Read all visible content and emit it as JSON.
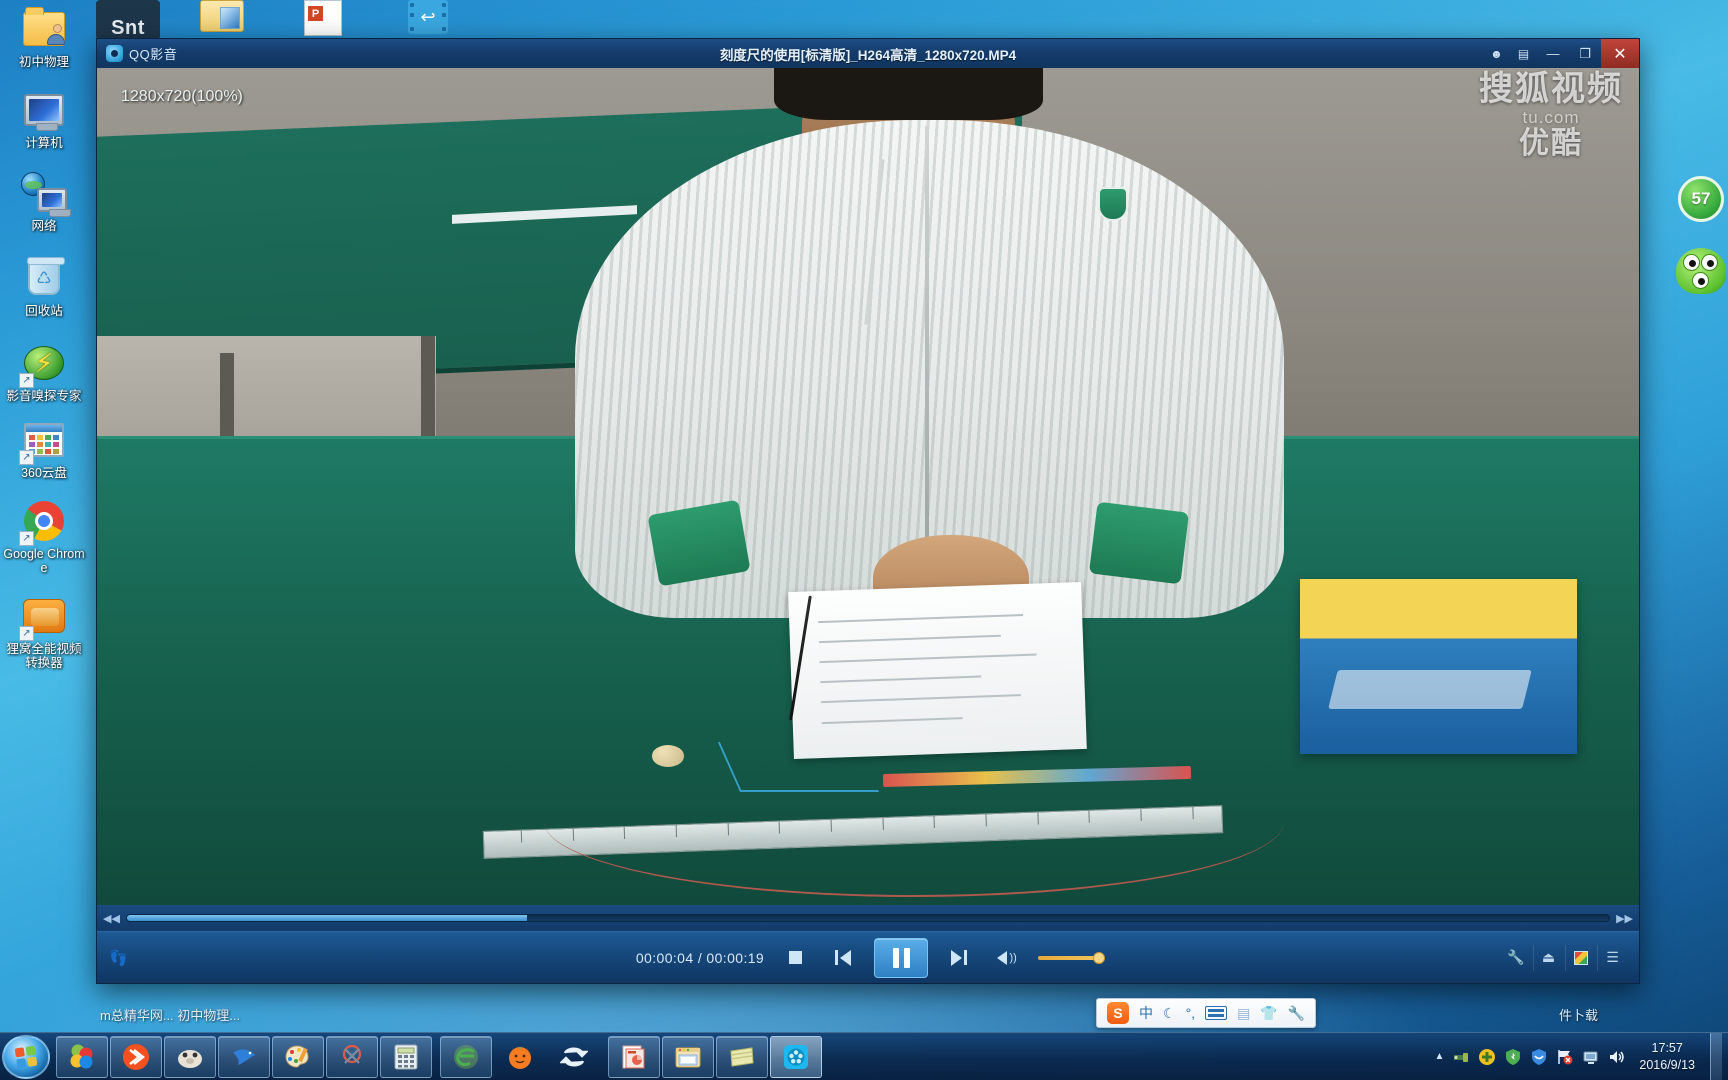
{
  "desktop": {
    "icons": [
      {
        "label": "初中物理",
        "icon": "folder-user-icon",
        "shortcut": false
      },
      {
        "label": "计算机",
        "icon": "computer-icon",
        "shortcut": false
      },
      {
        "label": "网络",
        "icon": "network-icon",
        "shortcut": false
      },
      {
        "label": "回收站",
        "icon": "recycle-bin-icon",
        "shortcut": false
      },
      {
        "label": "影音嗅探专家",
        "icon": "lightning-app-icon",
        "shortcut": true
      },
      {
        "label": "360云盘",
        "icon": "cloud-disk-icon",
        "shortcut": true
      },
      {
        "label": "Google Chrome",
        "icon": "chrome-icon",
        "shortcut": true
      },
      {
        "label": "狸窝全能视频转换器",
        "icon": "video-converter-icon",
        "shortcut": true
      }
    ],
    "top_row_icons": [
      {
        "label": "Snt",
        "icon": "snt-tile-icon"
      },
      {
        "label": "",
        "icon": "folder-icon"
      },
      {
        "label": "",
        "icon": "powerpoint-document-icon"
      },
      {
        "label": "",
        "icon": "video-convert-icon"
      }
    ],
    "float_right": {
      "badge_count": "57",
      "badge_name": "green-score-badge",
      "mascot_name": "green-mascot-icon"
    }
  },
  "player": {
    "app_name": "QQ影音",
    "app_logo": "qq-player-logo-icon",
    "title": "刻度尺的使用[标清版]_H264高清_1280x720.MP4",
    "titlebar_buttons": [
      {
        "name": "chat-icon",
        "glyph": "☻"
      },
      {
        "name": "feedback-icon",
        "glyph": "▤"
      },
      {
        "name": "minimize-icon",
        "glyph": "—"
      },
      {
        "name": "restore-icon",
        "glyph": "❐"
      },
      {
        "name": "close-icon",
        "glyph": "✕"
      }
    ],
    "resolution_badge": "1280x720(100%)",
    "watermarks": {
      "line1": "搜狐视频",
      "line2": "t​u.com",
      "line3": "优酷"
    },
    "progress": {
      "left_arrow": "◀◀",
      "percent": 27,
      "right_arrow": "▶▶"
    },
    "controls": {
      "time": "00:00:04 / 00:00:19",
      "current_time": "00:00:04",
      "total_time": "00:00:19",
      "stop_label": "停止",
      "prev_label": "上一个",
      "play_pause_label": "暂停",
      "play_state": "paused",
      "next_label": "下一个",
      "volume_label": "音量",
      "volume_percent": 100,
      "footprint_icon": "footprint-icon",
      "right_buttons": [
        {
          "name": "settings-wrench-icon",
          "glyph": "🔧"
        },
        {
          "name": "eject-icon",
          "glyph": "▲"
        },
        {
          "name": "screenshot-color-icon",
          "glyph": "◧"
        },
        {
          "name": "playlist-icon",
          "glyph": "☰"
        }
      ]
    }
  },
  "status_strip": {
    "left_text": "m总精华网...   初中物理...",
    "right_text": "件卜载"
  },
  "ime": {
    "logo": "S",
    "name": "sogou-ime-toolbar",
    "items": [
      {
        "name": "ime-mode-chinese",
        "glyph": "中"
      },
      {
        "name": "ime-moon-icon",
        "glyph": "🌙"
      },
      {
        "name": "ime-punctuation-icon",
        "glyph": "°,"
      },
      {
        "name": "ime-soft-keyboard-icon",
        "glyph": "⌨"
      },
      {
        "name": "ime-toolbox-icon",
        "glyph": "▤"
      },
      {
        "name": "ime-skin-icon",
        "glyph": "👕"
      },
      {
        "name": "ime-settings-icon",
        "glyph": "🔧"
      }
    ]
  },
  "taskbar": {
    "start_label": "开始",
    "items": [
      {
        "name": "taskbar-aero-colors",
        "glyph": "❀",
        "state": "pinned"
      },
      {
        "name": "taskbar-vlc-like",
        "glyph": "⟩",
        "state": "pinned"
      },
      {
        "name": "taskbar-hamster-app",
        "glyph": "◕",
        "state": "pinned"
      },
      {
        "name": "taskbar-bird-app",
        "glyph": "✈",
        "state": "pinned"
      },
      {
        "name": "taskbar-paint-app",
        "glyph": "🎨",
        "state": "pinned"
      },
      {
        "name": "taskbar-snipping-tool",
        "glyph": "✂",
        "state": "pinned"
      },
      {
        "name": "taskbar-calculator",
        "glyph": "🖩",
        "state": "pinned"
      },
      {
        "name": "taskbar-ie-browser",
        "glyph": "e",
        "state": "open"
      },
      {
        "name": "taskbar-orange-app",
        "glyph": "●",
        "state": "pinned"
      },
      {
        "name": "taskbar-sync-app",
        "glyph": "⇄",
        "state": "pinned"
      },
      {
        "name": "taskbar-powerpoint",
        "glyph": "P",
        "state": "open"
      },
      {
        "name": "taskbar-file-explorer",
        "glyph": "🗂",
        "state": "open"
      },
      {
        "name": "taskbar-notes-app",
        "glyph": "▤",
        "state": "open"
      },
      {
        "name": "taskbar-qq-player",
        "glyph": "◉",
        "state": "active"
      }
    ],
    "tray": {
      "overflow_arrow": "▲",
      "icons": [
        {
          "name": "tray-usb-icon",
          "glyph": "⚷"
        },
        {
          "name": "tray-update-icon",
          "glyph": "✚"
        },
        {
          "name": "tray-360-shield-icon",
          "glyph": "🛡"
        },
        {
          "name": "tray-antivirus-icon",
          "glyph": "◡"
        },
        {
          "name": "tray-action-center-icon",
          "glyph": "⚑"
        },
        {
          "name": "tray-network-icon",
          "glyph": "🖥"
        },
        {
          "name": "tray-volume-icon",
          "glyph": "🔊"
        }
      ],
      "time": "17:57",
      "date": "2016/9/13"
    }
  },
  "colors": {
    "desktop_blue": "#2a9ad6",
    "titlebar_blue": "#143c6b",
    "close_red": "#c1453a",
    "accent_light": "#7fc4f0",
    "volume_orange": "#e8a93a",
    "table_green": "#17624f"
  }
}
